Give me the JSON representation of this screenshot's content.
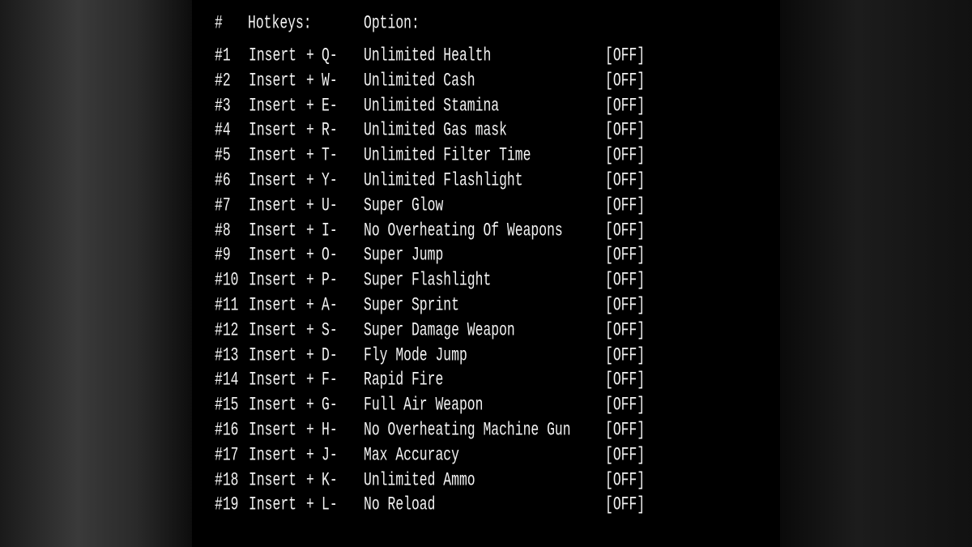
{
  "header": {
    "num": "#",
    "hotkeys": "Hotkeys:",
    "option": "Option:"
  },
  "rows": [
    {
      "num": "#1",
      "mod": "Insert",
      "key": "Q-",
      "option": "Unlimited Health",
      "state": "[OFF]"
    },
    {
      "num": "#2",
      "mod": "Insert",
      "key": "W-",
      "option": "Unlimited Cash",
      "state": "[OFF]"
    },
    {
      "num": "#3",
      "mod": "Insert",
      "key": "E-",
      "option": "Unlimited Stamina",
      "state": "[OFF]"
    },
    {
      "num": "#4",
      "mod": "Insert",
      "key": "R-",
      "option": "Unlimited Gas mask",
      "state": "[OFF]"
    },
    {
      "num": "#5",
      "mod": "Insert",
      "key": "T-",
      "option": "Unlimited Filter Time",
      "state": "[OFF]"
    },
    {
      "num": "#6",
      "mod": "Insert",
      "key": "Y-",
      "option": "Unlimited Flashlight",
      "state": "[OFF]"
    },
    {
      "num": "#7",
      "mod": "Insert",
      "key": "U-",
      "option": "Super Glow",
      "state": "[OFF]"
    },
    {
      "num": "#8",
      "mod": "Insert",
      "key": "I-",
      "option": "No Overheating Of Weapons",
      "state": "[OFF]"
    },
    {
      "num": "#9",
      "mod": "Insert",
      "key": "O-",
      "option": "Super Jump",
      "state": "[OFF]"
    },
    {
      "num": "#10",
      "mod": "Insert",
      "key": "P-",
      "option": "Super Flashlight",
      "state": "[OFF]"
    },
    {
      "num": "#11",
      "mod": "Insert",
      "key": "A-",
      "option": "Super Sprint",
      "state": "[OFF]"
    },
    {
      "num": "#12",
      "mod": "Insert",
      "key": "S-",
      "option": "Super Damage Weapon",
      "state": "[OFF]"
    },
    {
      "num": "#13",
      "mod": "Insert",
      "key": "D-",
      "option": "Fly Mode Jump",
      "state": "[OFF]"
    },
    {
      "num": "#14",
      "mod": "Insert",
      "key": "F-",
      "option": "Rapid Fire",
      "state": "[OFF]"
    },
    {
      "num": "#15",
      "mod": "Insert",
      "key": "G-",
      "option": "Full Air Weapon",
      "state": "[OFF]"
    },
    {
      "num": "#16",
      "mod": "Insert",
      "key": "H-",
      "option": "No Overheating Machine Gun",
      "state": "[OFF]"
    },
    {
      "num": "#17",
      "mod": "Insert",
      "key": "J-",
      "option": "Max Accuracy",
      "state": "[OFF]"
    },
    {
      "num": "#18",
      "mod": "Insert",
      "key": "K-",
      "option": "Unlimited Ammo",
      "state": "[OFF]"
    },
    {
      "num": "#19",
      "mod": "Insert",
      "key": "L-",
      "option": "No Reload",
      "state": "[OFF]"
    }
  ],
  "plus": "+"
}
